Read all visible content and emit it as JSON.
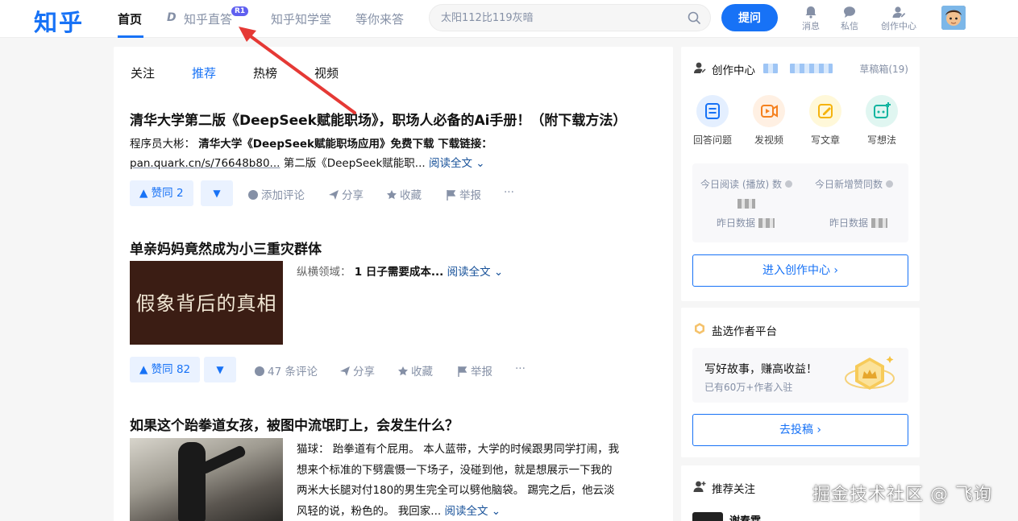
{
  "header": {
    "logo": "知乎",
    "nav": [
      "首页",
      "知乎直答",
      "知乎知学堂",
      "等你来答"
    ],
    "nav_badge": "R1",
    "search_placeholder": "太阳112比119灰暗",
    "ask_label": "提问",
    "icons": [
      {
        "label": "消息",
        "icon": "bell-icon"
      },
      {
        "label": "私信",
        "icon": "chat-icon"
      },
      {
        "label": "创作中心",
        "icon": "creator-icon"
      }
    ]
  },
  "tabs": [
    "关注",
    "推荐",
    "热榜",
    "视频"
  ],
  "feed": [
    {
      "title": "清华大学第二版《DeepSeek赋能职场》，职场人必备的Ai手册！（附下载方法）",
      "author": "程序员大彬：",
      "excerpt_bold": "清华大学《DeepSeek赋能职场应用》免费下载 下载链接：",
      "link": "pan.quark.cn/s/76648b80...",
      "excerpt_tail": " 第二版《DeepSeek赋能职...",
      "read_more": "阅读全文",
      "vote": "▲ 赞同 2",
      "comments": "添加评论"
    },
    {
      "title": "单亲妈妈竟然成为小三重灾群体",
      "thumb_text": "假象背后的真相",
      "author": "纵横领域：",
      "excerpt_bold": "1 日子需要成本...",
      "read_more": "阅读全文",
      "vote": "▲ 赞同 82",
      "comments": "47 条评论"
    },
    {
      "title": "如果这个跆拳道女孩，被图中流氓盯上，会发生什么？",
      "author": "猫球：",
      "lines": [
        "跆拳道有个屁用。 本人蓝带，大学的时候跟男同学打闹，我",
        "想来个标准的下劈震慑一下场子，没碰到他，就是想展示一下我的",
        "两米大长腿对付180的男生完全可以劈他脑袋。 踢完之后，他云淡",
        "风轻的说，粉色的。 我回家..."
      ],
      "read_more": "阅读全文"
    }
  ],
  "actions": {
    "share": "分享",
    "collect": "收藏",
    "report": "举报",
    "more": "···"
  },
  "creator": {
    "title": "创作中心",
    "drafts": "草稿箱(19)",
    "quick": [
      "回答问题",
      "发视频",
      "写文章",
      "写想法"
    ],
    "stat1": "今日阅读 (播放) 数",
    "stat2": "今日新增赞同数",
    "yesterday": "昨日数据",
    "enter": "进入创作中心 ›"
  },
  "yanxuan": {
    "title": "盐选作者平台",
    "headline": "写好故事，赚高收益！",
    "sub": "已有60万+作者入驻",
    "button": "去投稿 ›"
  },
  "recommend": {
    "title": "推荐关注",
    "name": "谢春霖"
  },
  "watermark": "掘金技术社区 @ 飞询",
  "colors": {
    "brand": "#1772f6",
    "annotation_arrow": "#e53935"
  }
}
